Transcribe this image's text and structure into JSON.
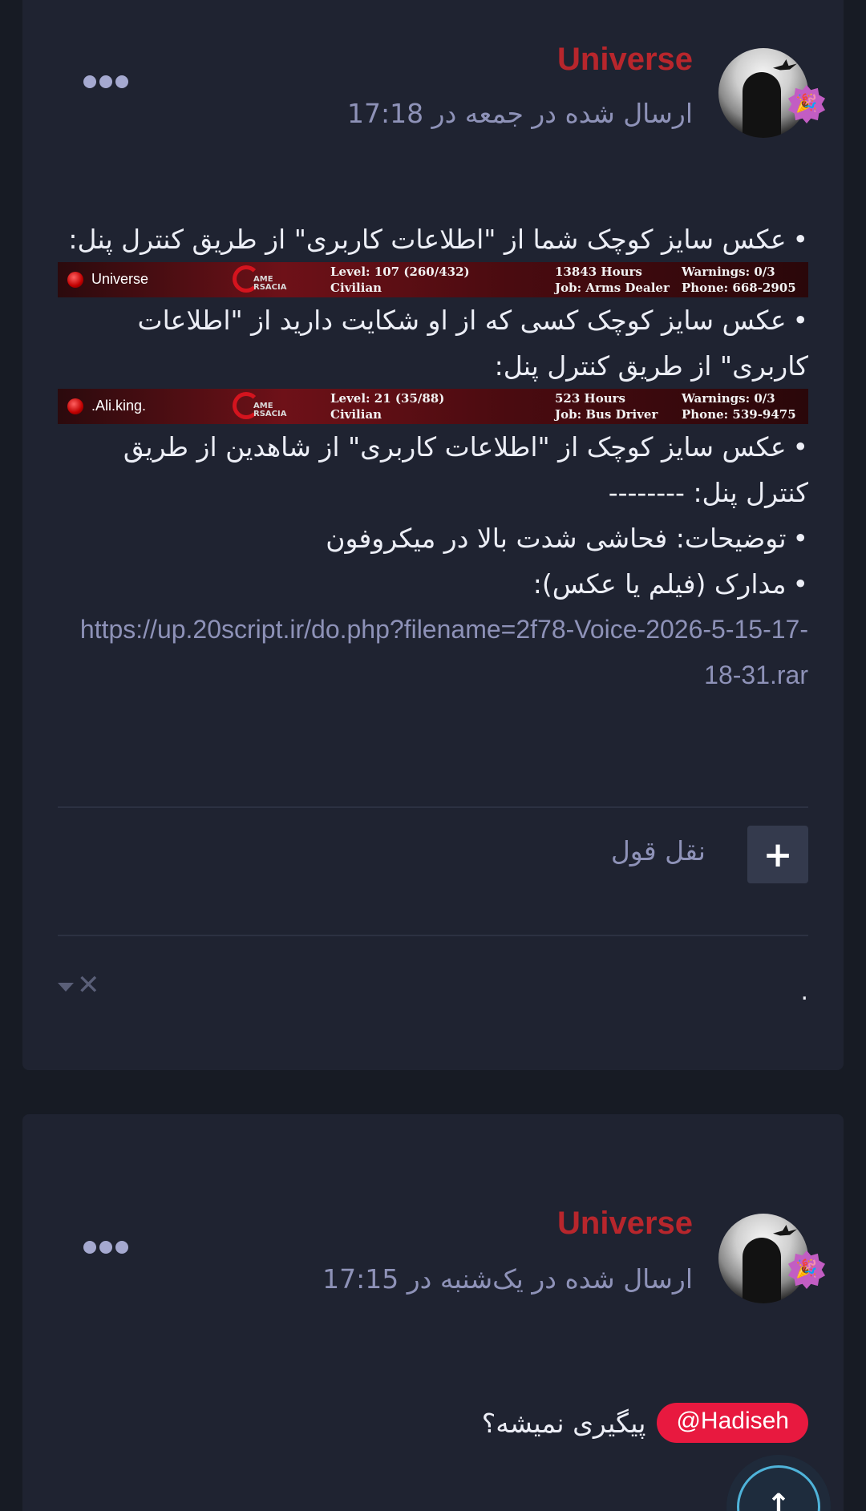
{
  "posts": [
    {
      "author": "Universe",
      "date": "ارسال شده در جمعه در 17:18",
      "badge_glyph": "🎉",
      "content": {
        "line1": "عکس سایز کوچک شما از \"اطلاعات کاربری\" از طریق کنترل پنل:",
        "bar1": {
          "name": "Universe",
          "logo_text_top": "AME",
          "logo_text_bottom": "RSACIA",
          "level": "Level: 107 (260/432)",
          "group": "Civilian",
          "hours": "13843 Hours",
          "job": "Job: Arms Dealer",
          "warnings": "Warnings: 0/3",
          "phone": "Phone: 668-2905"
        },
        "line2": "عکس سایز کوچک کسی که از او شکایت دارید از \"اطلاعات کاربری\" از طریق کنترل پنل:",
        "bar2": {
          "name": ".Ali.king.",
          "logo_text_top": "AME",
          "logo_text_bottom": "RSACIA",
          "level": "Level: 21 (35/88)",
          "group": "Civilian",
          "hours": "523 Hours",
          "job": "Job: Bus Driver",
          "warnings": "Warnings: 0/3",
          "phone": "Phone: 539-9475"
        },
        "line3": "عکس سایز کوچک از \"اطلاعات کاربری\"  از شاهدین از طریق کنترل پنل: --------",
        "line4": "توضیحات: فحاشی شدت بالا در میکروفون",
        "line5": "مدارک (فیلم یا عکس):",
        "link": "https://up.20script.ir/do.php?filename=2f78-Voice-2026-5-15-17-18-31.rar"
      },
      "quote_plus": "+",
      "quote_label": "نقل قول",
      "reaction_dot": ".",
      "close_glyph": "✕"
    },
    {
      "author": "Universe",
      "date": "ارسال شده در یک‌شنبه در 17:15",
      "badge_glyph": "🎉",
      "mention": "@Hadiseh",
      "mention_text": "پیگیری نمیشه؟"
    }
  ],
  "scroll_top_glyph": "↑",
  "colors": {
    "page_bg": "#171b24",
    "card_bg": "#1f2331",
    "author": "#b8262c",
    "muted": "#8e92b8",
    "mention": "#e8193f",
    "badge": "#c25dc3"
  }
}
